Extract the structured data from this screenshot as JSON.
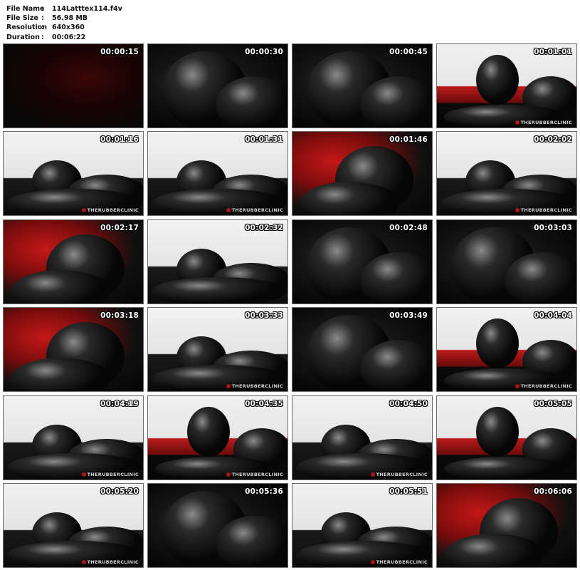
{
  "file_info": [
    {
      "label": "File Name",
      "sep": ":",
      "value": "114Latttex114.f4v"
    },
    {
      "label": "File Size",
      "sep": ":",
      "value": "56.98 MB"
    },
    {
      "label": "Resolution",
      "sep": ":",
      "value": "640x360"
    },
    {
      "label": "Duration",
      "sep": ":",
      "value": "00:06:22"
    }
  ],
  "thumbnails": [
    {
      "time": "00:00:15",
      "scene": "intro"
    },
    {
      "time": "00:00:30",
      "scene": "dark"
    },
    {
      "time": "00:00:45",
      "scene": "dark"
    },
    {
      "time": "00:01:01",
      "scene": "redbright",
      "watermark": "THERUBBERCLINIC"
    },
    {
      "time": "00:01:16",
      "scene": "bright",
      "watermark": "THERUBBERCLINIC"
    },
    {
      "time": "00:01:31",
      "scene": "bright",
      "watermark": "THERUBBERCLINIC"
    },
    {
      "time": "00:01:46",
      "scene": "red"
    },
    {
      "time": "00:02:02",
      "scene": "bright",
      "watermark": "THERUBBERCLINIC"
    },
    {
      "time": "00:02:17",
      "scene": "red"
    },
    {
      "time": "00:02:32",
      "scene": "bright"
    },
    {
      "time": "00:02:48",
      "scene": "dark"
    },
    {
      "time": "00:03:03",
      "scene": "dark"
    },
    {
      "time": "00:03:18",
      "scene": "red"
    },
    {
      "time": "00:03:33",
      "scene": "bright",
      "watermark": "THERUBBERCLINIC"
    },
    {
      "time": "00:03:49",
      "scene": "dark"
    },
    {
      "time": "00:04:04",
      "scene": "redbright",
      "watermark": "THERUBBERCLINIC"
    },
    {
      "time": "00:04:19",
      "scene": "bright",
      "watermark": "THERUBBERCLINIC"
    },
    {
      "time": "00:04:35",
      "scene": "redbright",
      "watermark": "THERUBBERCLINIC"
    },
    {
      "time": "00:04:50",
      "scene": "bright",
      "watermark": "THERUBBERCLINIC"
    },
    {
      "time": "00:05:05",
      "scene": "redbright"
    },
    {
      "time": "00:05:20",
      "scene": "bright",
      "watermark": "THERUBBERCLINIC"
    },
    {
      "time": "00:05:36",
      "scene": "dark"
    },
    {
      "time": "00:05:51",
      "scene": "bright",
      "watermark": "THERUBBERCLINIC"
    },
    {
      "time": "00:06:06",
      "scene": "red"
    }
  ]
}
